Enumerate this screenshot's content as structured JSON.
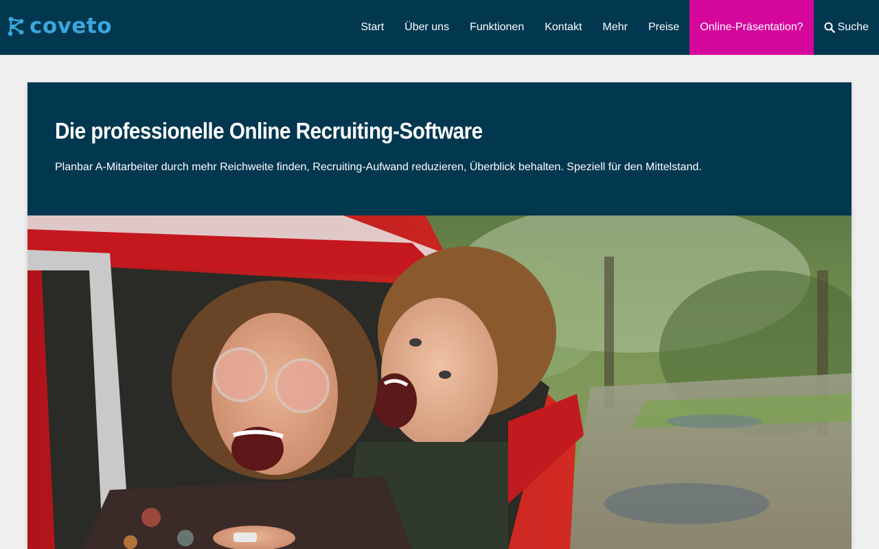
{
  "brand": {
    "name": "coveto",
    "logo_icon": "coveto-network-icon",
    "color": "#3aa6dc"
  },
  "nav": {
    "items": [
      {
        "label": "Start"
      },
      {
        "label": "Über uns"
      },
      {
        "label": "Funktionen"
      },
      {
        "label": "Kontakt"
      },
      {
        "label": "Mehr"
      },
      {
        "label": "Preise"
      }
    ],
    "cta_label": "Online-Präsentation?",
    "search_label": "Suche",
    "search_icon": "search-icon"
  },
  "hero": {
    "title": "Die professionelle Online Recruiting-Software",
    "subtitle": "Planbar A-Mitarbeiter durch mehr Reichweite finden, Recruiting-Aufwand reduzieren, Überblick behalten. Speziell für den Mittelstand.",
    "image": "photo-two-people-in-red-van"
  },
  "colors": {
    "header_bg": "#01374f",
    "cta_bg": "#d4069c",
    "page_bg": "#efefef"
  }
}
